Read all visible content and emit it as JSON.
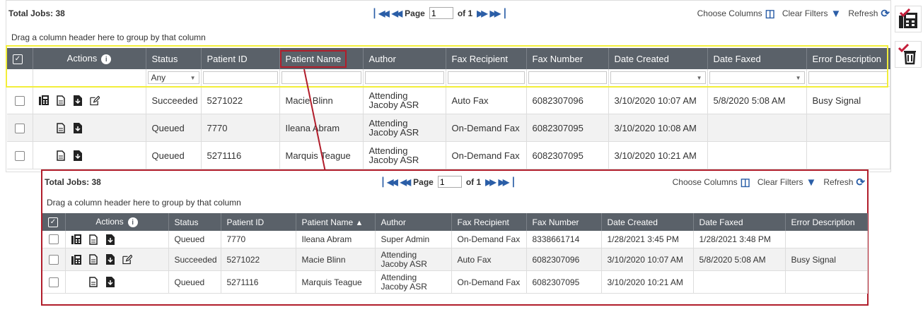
{
  "top": {
    "total_jobs": "Total Jobs: 38",
    "pager": {
      "page_label": "Page",
      "page_value": "1",
      "of_label": "of 1"
    },
    "choose_columns": "Choose Columns",
    "clear_filters": "Clear Filters",
    "refresh": "Refresh",
    "group_hint": "Drag a column header here to group by that column",
    "columns": [
      "Actions",
      "Status",
      "Patient ID",
      "Patient Name",
      "Author",
      "Fax Recipient",
      "Fax Number",
      "Date Created",
      "Date Faxed",
      "Error Description"
    ],
    "status_filter": "Any",
    "rows": [
      {
        "status": "Succeeded",
        "patient_id": "5271022",
        "patient_name": "Macie Blinn",
        "author1": "Attending",
        "author2": "Jacoby ASR",
        "recipient": "Auto Fax",
        "fax_number": "6082307096",
        "created": "3/10/2020 10:07 AM",
        "faxed": "5/8/2020 5:08 AM",
        "error": "Busy Signal"
      },
      {
        "status": "Queued",
        "patient_id": "7770",
        "patient_name": "Ileana Abram",
        "author1": "Attending",
        "author2": "Jacoby ASR",
        "recipient": "On-Demand Fax",
        "fax_number": "6082307095",
        "created": "3/10/2020 10:08 AM",
        "faxed": "",
        "error": ""
      },
      {
        "status": "Queued",
        "patient_id": "5271116",
        "patient_name": "Marquis Teague",
        "author1": "Attending",
        "author2": "Jacoby ASR",
        "recipient": "On-Demand Fax",
        "fax_number": "6082307095",
        "created": "3/10/2020 10:21 AM",
        "faxed": "",
        "error": ""
      }
    ]
  },
  "bottom": {
    "total_jobs": "Total Jobs: 38",
    "pager": {
      "page_label": "Page",
      "page_value": "1",
      "of_label": "of 1"
    },
    "choose_columns": "Choose Columns",
    "clear_filters": "Clear Filters",
    "refresh": "Refresh",
    "group_hint": "Drag a column header here to group by that column",
    "columns": [
      "Actions",
      "Status",
      "Patient ID",
      "Patient Name",
      "Author",
      "Fax Recipient",
      "Fax Number",
      "Date Created",
      "Date Faxed",
      "Error Description"
    ],
    "sort_indicator": "▲",
    "rows": [
      {
        "status": "Queued",
        "patient_id": "7770",
        "patient_name": "Ileana Abram",
        "author1": "Super Admin",
        "author2": "",
        "recipient": "On-Demand Fax",
        "fax_number": "8338661714",
        "created": "1/28/2021 3:45 PM",
        "faxed": "1/28/2021 3:48 PM",
        "error": ""
      },
      {
        "status": "Succeeded",
        "patient_id": "5271022",
        "patient_name": "Macie Blinn",
        "author1": "Attending",
        "author2": "Jacoby ASR",
        "recipient": "Auto Fax",
        "fax_number": "6082307096",
        "created": "3/10/2020 10:07 AM",
        "faxed": "5/8/2020 5:08 AM",
        "error": "Busy Signal"
      },
      {
        "status": "Queued",
        "patient_id": "5271116",
        "patient_name": "Marquis Teague",
        "author1": "Attending",
        "author2": "Jacoby ASR",
        "recipient": "On-Demand Fax",
        "fax_number": "6082307095",
        "created": "3/10/2020 10:21 AM",
        "faxed": "",
        "error": ""
      }
    ]
  },
  "colors": {
    "accent": "#2b5ea7",
    "header_bg": "#5a6169",
    "highlight_yellow": "#f2ee3a",
    "highlight_red": "#b11d2b"
  },
  "icons": [
    "first-page-icon",
    "prev-page-icon",
    "next-page-icon",
    "last-page-icon",
    "columns-icon",
    "filter-icon",
    "refresh-icon",
    "fax-icon",
    "document-icon",
    "download-icon",
    "edit-icon",
    "info-icon"
  ]
}
